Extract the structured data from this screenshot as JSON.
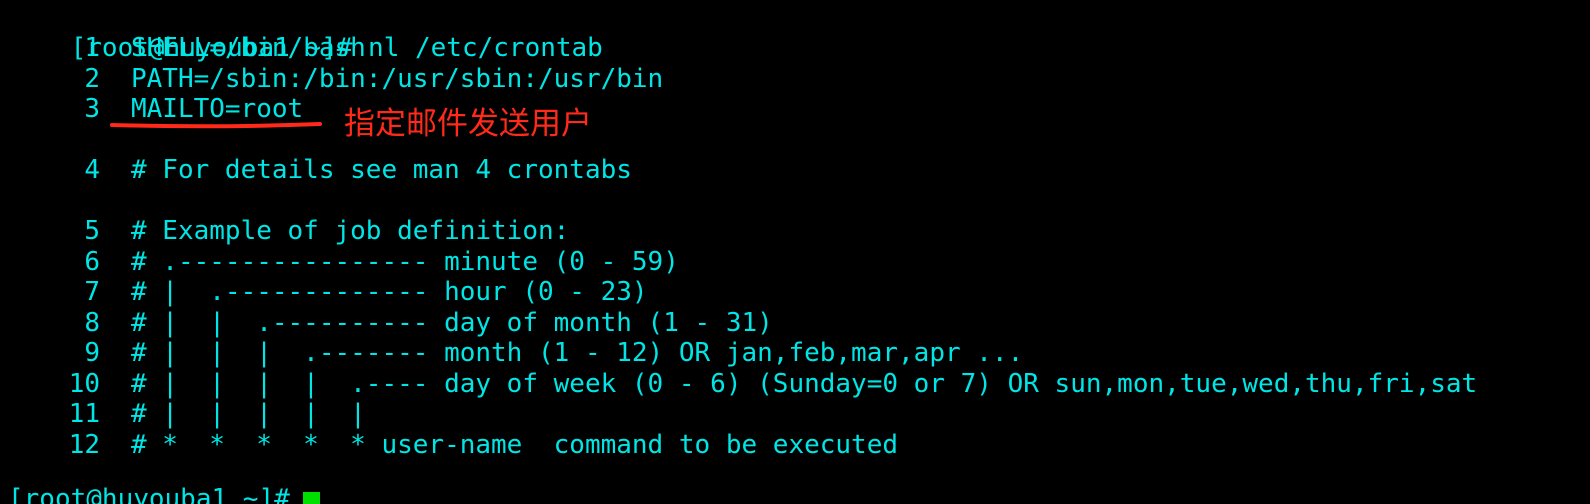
{
  "terminal": {
    "command_line": "[root@huyouba1 ~]# nl /etc/crontab",
    "lines": [
      {
        "num": "1",
        "text": "SHELL=/bin/bash"
      },
      {
        "num": "2",
        "text": "PATH=/sbin:/bin:/usr/sbin:/usr/bin"
      },
      {
        "num": "3",
        "text": "MAILTO=root"
      },
      {
        "num": "4",
        "text": "# For details see man 4 crontabs"
      },
      {
        "num": "5",
        "text": "# Example of job definition:"
      },
      {
        "num": "6",
        "text": "# .---------------- minute (0 - 59)"
      },
      {
        "num": "7",
        "text": "# |  .------------- hour (0 - 23)"
      },
      {
        "num": "8",
        "text": "# |  |  .---------- day of month (1 - 31)"
      },
      {
        "num": "9",
        "text": "# |  |  |  .------- month (1 - 12) OR jan,feb,mar,apr ..."
      },
      {
        "num": "10",
        "text": "# |  |  |  |  .---- day of week (0 - 6) (Sunday=0 or 7) OR sun,mon,tue,wed,thu,fri,sat"
      },
      {
        "num": "11",
        "text": "# |  |  |  |  |"
      },
      {
        "num": "12",
        "text": "# *  *  *  *  * user-name  command to be executed"
      }
    ],
    "next_prompt": "[root@huyouba1 ~]# ",
    "annotation": "指定邮件发送用户",
    "colors": {
      "background": "#000000",
      "text": "#00e5e5",
      "annotation": "#ff2a1a",
      "cursor": "#00e000"
    }
  }
}
